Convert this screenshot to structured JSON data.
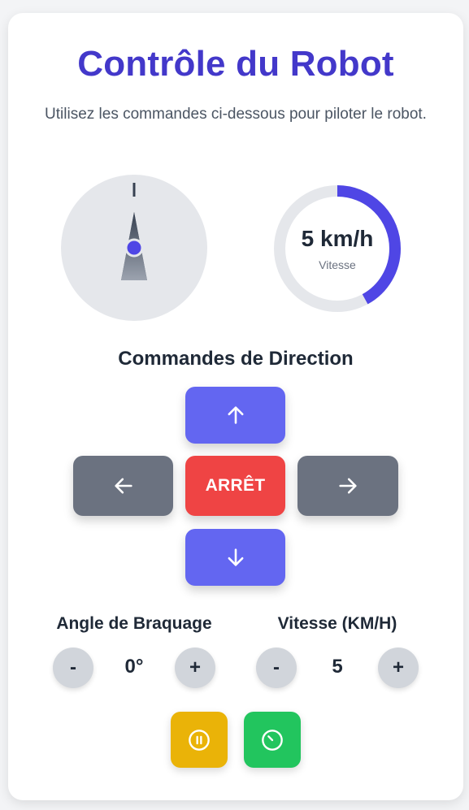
{
  "header": {
    "title": "Contrôle du Robot",
    "subtitle": "Utilisez les commandes ci-dessous pour piloter le robot."
  },
  "compass": {
    "heading_deg": 0,
    "icon": "compass-needle-icon"
  },
  "speed_gauge": {
    "value_text": "5 km/h",
    "label": "Vitesse",
    "fill_fraction": 0.42,
    "fill_color": "#4f46e5",
    "track_color": "#e5e7eb"
  },
  "direction": {
    "title": "Commandes de Direction",
    "up_icon": "arrow-up-icon",
    "down_icon": "arrow-down-icon",
    "left_icon": "arrow-left-icon",
    "right_icon": "arrow-right-icon",
    "stop_label": "ARRÊT"
  },
  "steering": {
    "label": "Angle de Braquage",
    "value": "0°",
    "minus": "-",
    "plus": "+"
  },
  "speed_control": {
    "label": "Vitesse (KM/H)",
    "value": "5",
    "minus": "-",
    "plus": "+"
  },
  "actions": {
    "pause_icon": "pause-icon",
    "timer_icon": "timer-icon",
    "pause_color": "#eab308",
    "timer_color": "#22c55e"
  },
  "colors": {
    "accent": "#4338ca",
    "primary_button": "#6366f1",
    "stop_button": "#ef4444",
    "neutral_button": "#6b7280"
  }
}
